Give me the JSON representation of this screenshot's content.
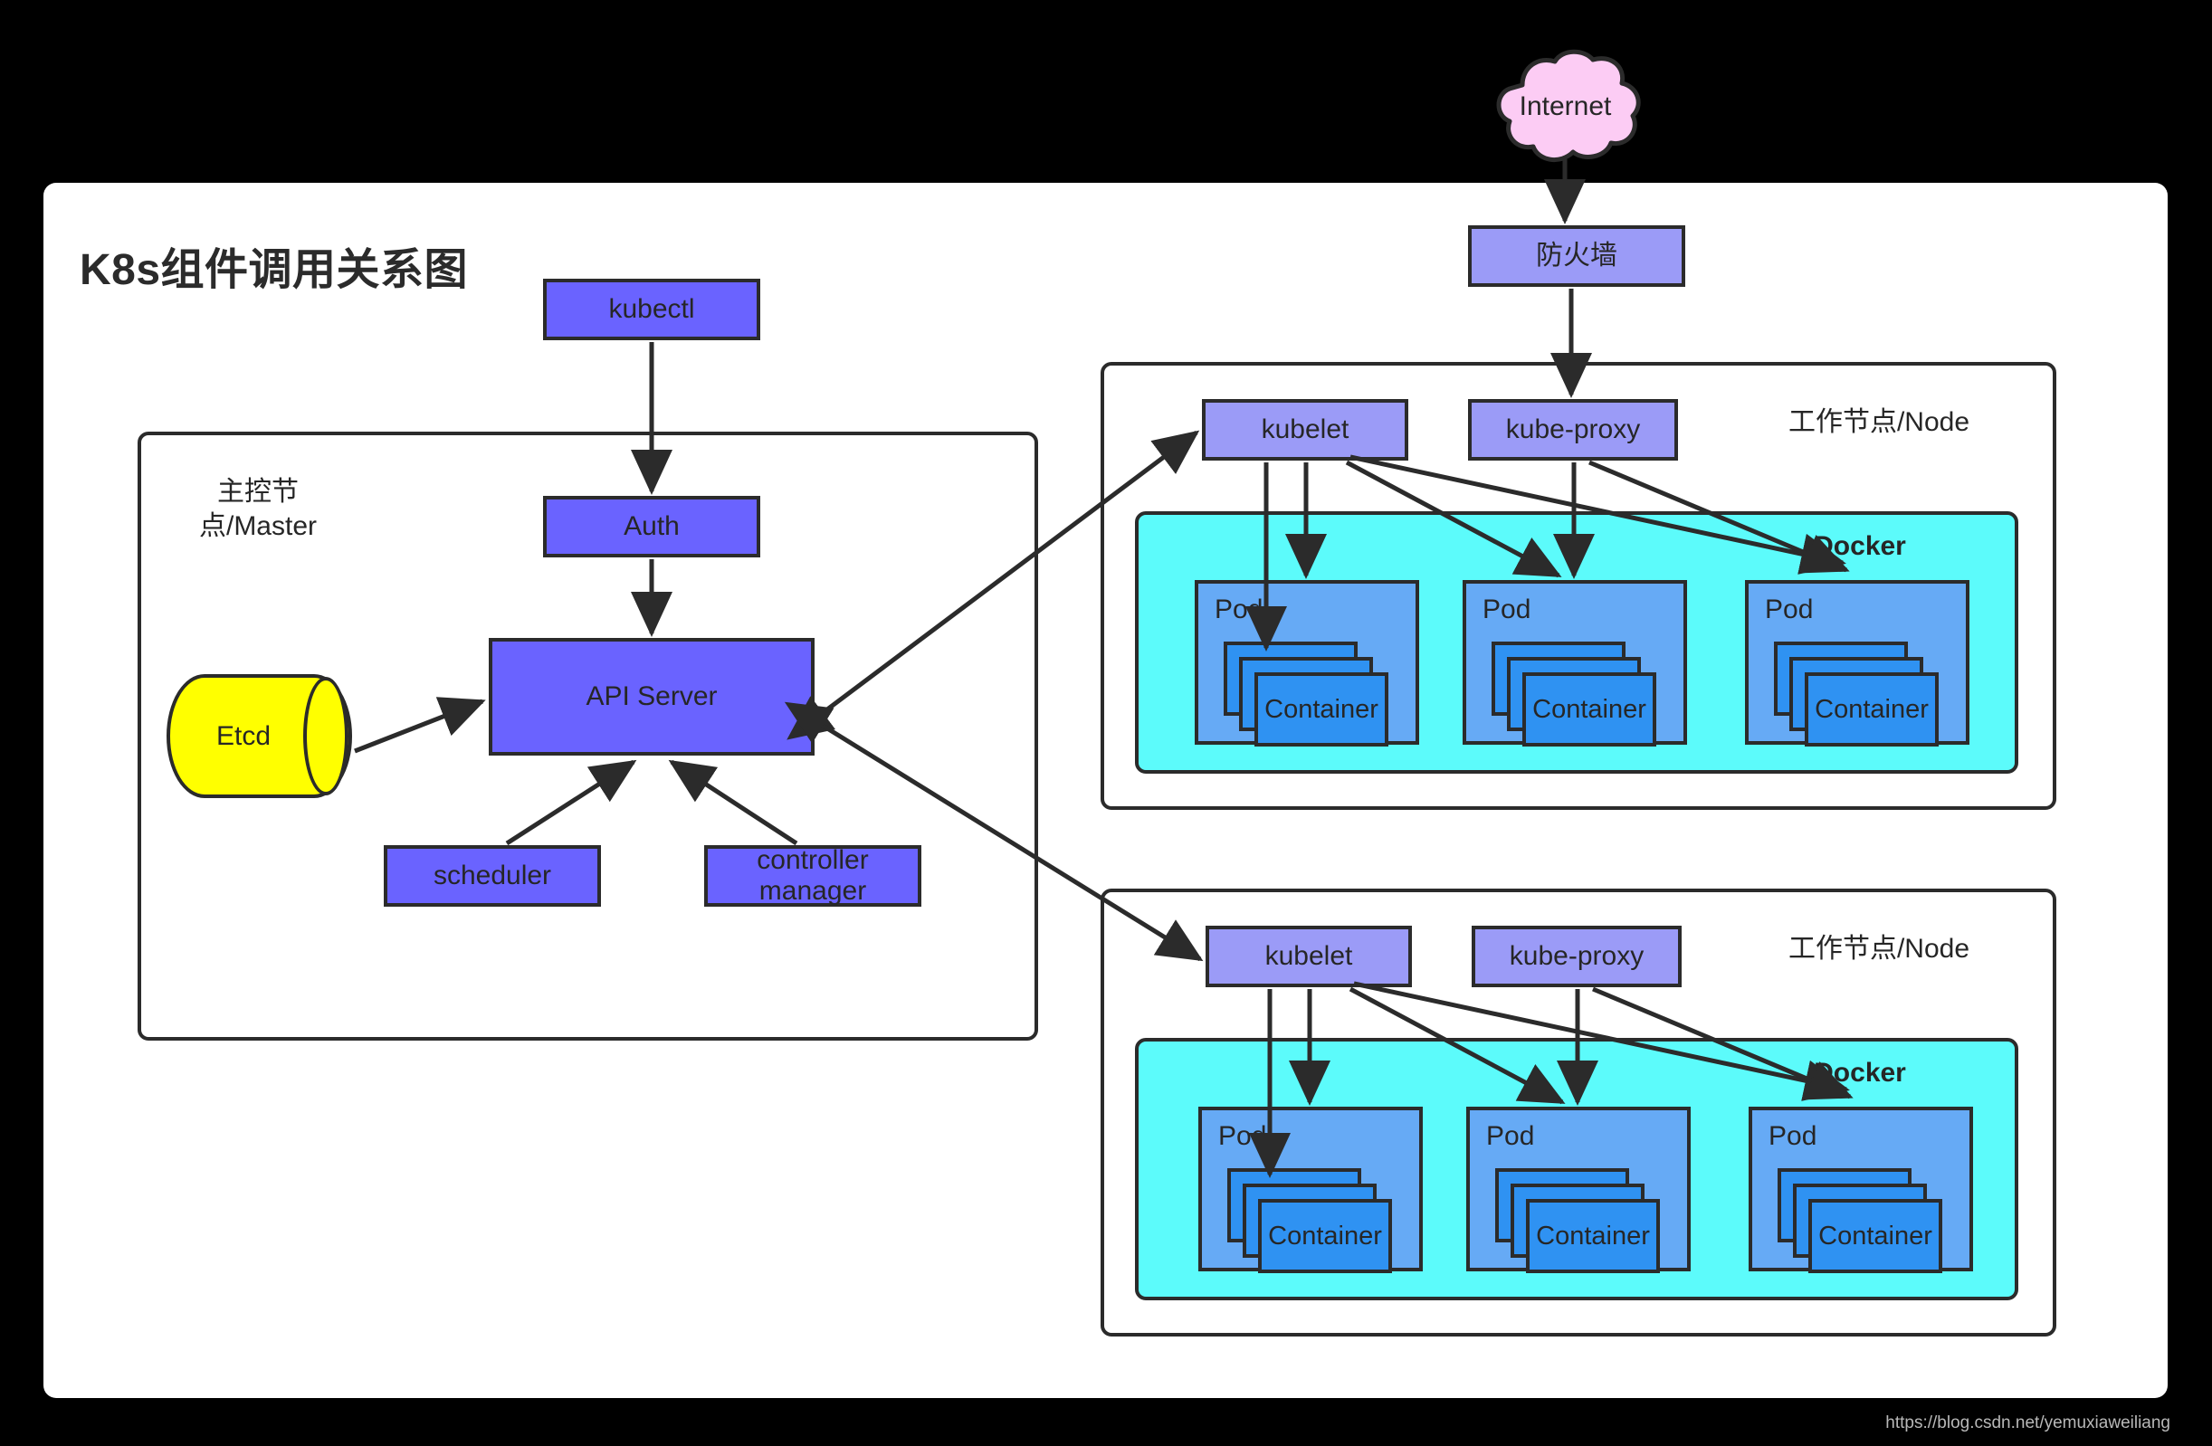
{
  "title": "K8s组件调用关系图",
  "watermark": "https://blog.csdn.net/yemuxiaweiliang",
  "colors": {
    "canvas": "#ffffff",
    "page_background": "#000000",
    "stroke": "#2b2b2b",
    "indigo": "#6a63ff",
    "periwinkle": "#9b9bf7",
    "cloud_pink": "#fcccf4",
    "etcd_yellow": "#ffff00",
    "docker_cyan": "#5cfbfb",
    "pod_blue": "#66aaf5",
    "container_blue": "#2f92f2"
  },
  "external": {
    "cloud_label": "Internet",
    "firewall_label": "防火墙"
  },
  "master": {
    "group_label": "主控节\n点/Master",
    "kubectl_label": "kubectl",
    "auth_label": "Auth",
    "api_server_label": "API Server",
    "etcd_label": "Etcd",
    "scheduler_label": "scheduler",
    "controller_manager_label": "controller\nmanager"
  },
  "worker_nodes": [
    {
      "group_label": "工作节点/Node",
      "kubelet_label": "kubelet",
      "kube_proxy_label": "kube-proxy",
      "docker_label": "Docker",
      "pods": [
        {
          "pod_label": "Pod",
          "container_label": "Container"
        },
        {
          "pod_label": "Pod",
          "container_label": "Container"
        },
        {
          "pod_label": "Pod",
          "container_label": "Container"
        }
      ]
    },
    {
      "group_label": "工作节点/Node",
      "kubelet_label": "kubelet",
      "kube_proxy_label": "kube-proxy",
      "docker_label": "Docker",
      "pods": [
        {
          "pod_label": "Pod",
          "container_label": "Container"
        },
        {
          "pod_label": "Pod",
          "container_label": "Container"
        },
        {
          "pod_label": "Pod",
          "container_label": "Container"
        }
      ]
    }
  ]
}
